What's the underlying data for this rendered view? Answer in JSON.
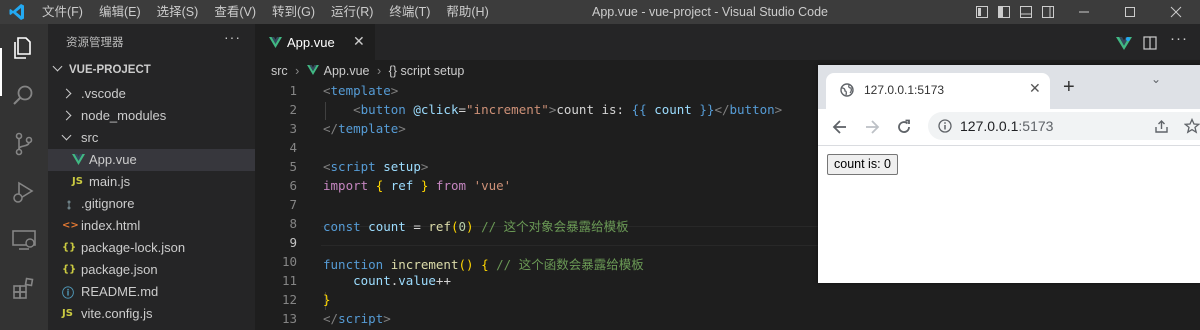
{
  "titlebar": {
    "menu": [
      "文件(F)",
      "编辑(E)",
      "选择(S)",
      "查看(V)",
      "转到(G)",
      "运行(R)",
      "终端(T)",
      "帮助(H)"
    ],
    "title": "App.vue - vue-project - Visual Studio Code"
  },
  "sidebar": {
    "title": "资源管理器",
    "more": "···",
    "project": "VUE-PROJECT",
    "items": [
      {
        "label": ".vscode"
      },
      {
        "label": "node_modules"
      },
      {
        "label": "src"
      },
      {
        "label": "App.vue",
        "icon": "V"
      },
      {
        "label": "main.js",
        "icon": "JS"
      },
      {
        "label": ".gitignore"
      },
      {
        "label": "index.html",
        "icon": "<>"
      },
      {
        "label": "package-lock.json",
        "icon": "{}"
      },
      {
        "label": "package.json",
        "icon": "{}"
      },
      {
        "label": "README.md",
        "icon": "ⓘ"
      },
      {
        "label": "vite.config.js",
        "icon": "JS"
      }
    ]
  },
  "editor": {
    "tab": "App.vue",
    "breadcrumb": [
      "src",
      "App.vue",
      "{} script setup"
    ],
    "line_numbers": [
      "1",
      "2",
      "3",
      "4",
      "5",
      "6",
      "7",
      "8",
      "9",
      "10",
      "11",
      "12",
      "13"
    ],
    "code": {
      "l1_tag": "template",
      "l2_tag": "button",
      "l2_attr": "@click",
      "l2_val": "\"increment\"",
      "l2_text": "count is: ",
      "l2_open": "{{",
      "l2_var": "count",
      "l2_close": "}}",
      "l3_tag": "template",
      "l5_tag": "script",
      "l5_attr": "setup",
      "l6_kw": "import",
      "l6_ref": "ref",
      "l6_from": "from",
      "l6_str": "'vue'",
      "l8_kw": "const",
      "l8_var": "count",
      "l8_fn": "ref",
      "l8_num": "0",
      "l8_cmt": "// 这个对象会暴露给模板",
      "l10_kw": "function",
      "l10_fn": "increment",
      "l10_cmt": "// 这个函数会暴露给模板",
      "l11_obj": "count",
      "l11_prop": "value",
      "l11_op": "++",
      "l12_br": "}",
      "l13_tag": "script"
    }
  },
  "browser": {
    "tab_title": "127.0.0.1:5173",
    "address_host": "127.0.0.1",
    "address_port": ":5173",
    "button_label": "count is: 0"
  },
  "colors": {
    "vscode_blue": "#23a9f2",
    "vue_green": "#41b883"
  }
}
